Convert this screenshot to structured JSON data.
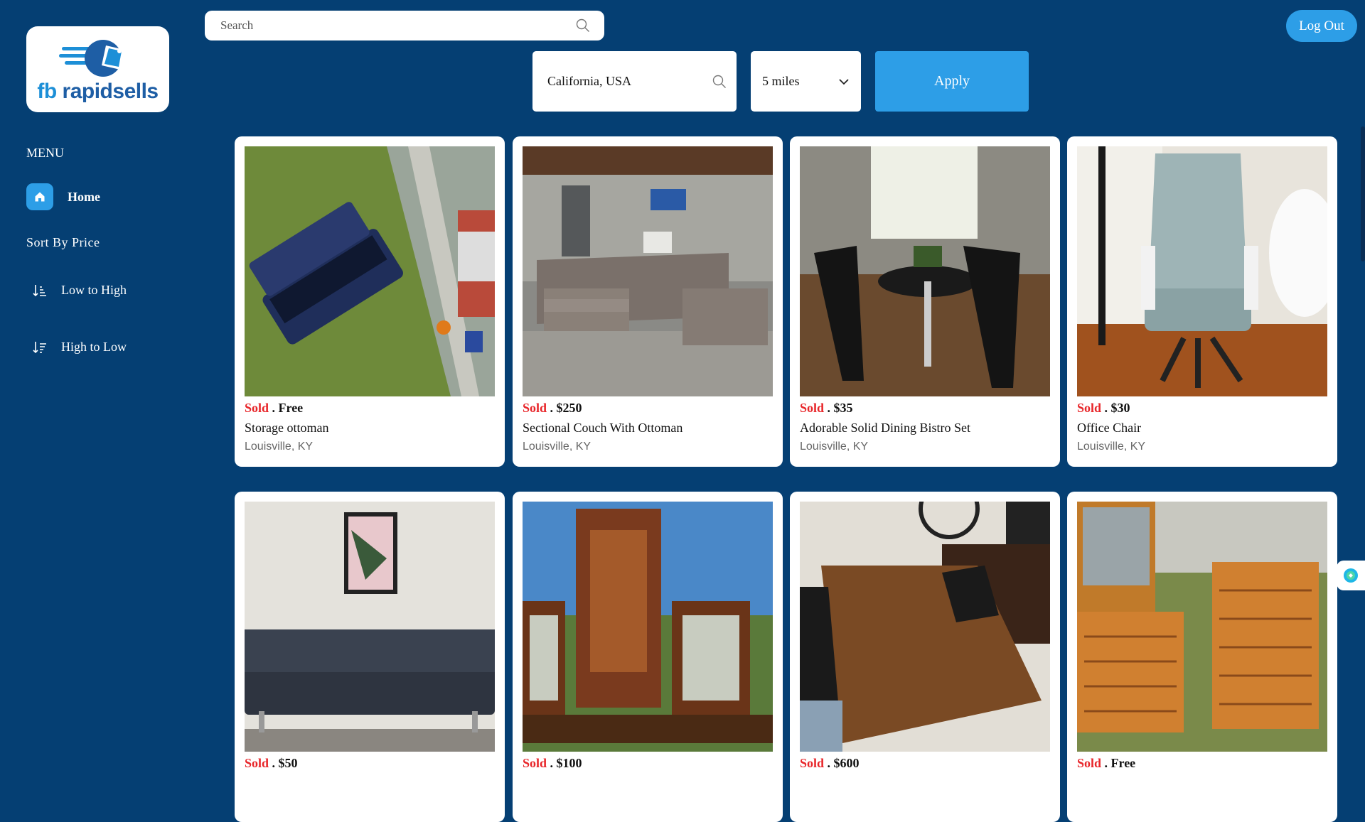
{
  "brand": {
    "logo_text_fb": "fb",
    "logo_text_rest": " rapidsells"
  },
  "sidebar": {
    "menu_title": "MENU",
    "home_label": "Home",
    "sort_title": "Sort By Price",
    "sort_low": "Low to High",
    "sort_high": "High to Low"
  },
  "header": {
    "search_placeholder": "Search",
    "logout_label": "Log Out",
    "location_value": "California, USA",
    "radius_value": "5 miles",
    "apply_label": "Apply"
  },
  "listings": [
    {
      "status": "Sold",
      "price": " . Free",
      "title": "Storage ottoman",
      "location": "Louisville, KY"
    },
    {
      "status": "Sold",
      "price": " . $250",
      "title": "Sectional Couch With Ottoman",
      "location": "Louisville, KY"
    },
    {
      "status": "Sold",
      "price": " . $35",
      "title": "Adorable Solid Dining Bistro Set",
      "location": "Louisville, KY"
    },
    {
      "status": "Sold",
      "price": " . $30",
      "title": "Office Chair",
      "location": "Louisville, KY"
    },
    {
      "status": "Sold",
      "price": " . $50"
    },
    {
      "status": "Sold",
      "price": " . $100"
    },
    {
      "status": "Sold",
      "price": " . $600"
    },
    {
      "status": "Sold",
      "price": " . Free"
    }
  ],
  "colors": {
    "background": "#053f73",
    "accent": "#2d9ee7",
    "sold": "#e8262a"
  }
}
